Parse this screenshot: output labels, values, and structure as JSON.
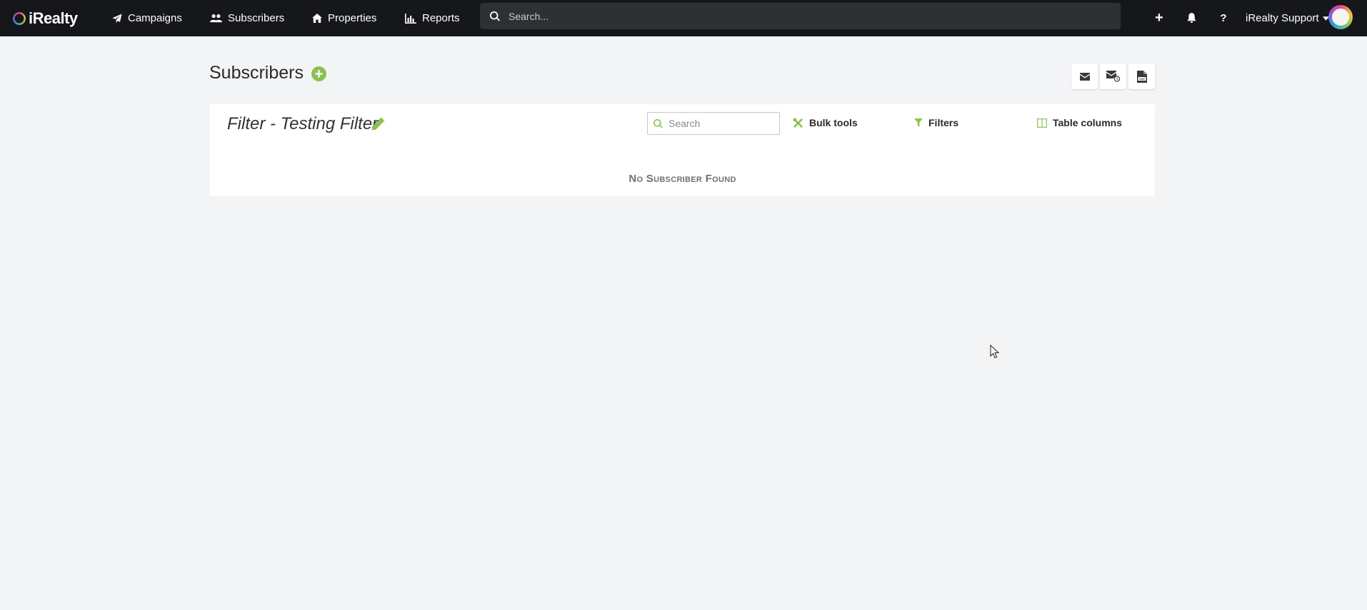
{
  "app": {
    "brand": "iRealty",
    "colors": {
      "nav_bg": "#15171a",
      "accent_green": "#8cc152",
      "page_bg": "#f3f4f6"
    }
  },
  "nav": {
    "items": [
      {
        "label": "Campaigns",
        "icon": "paper-plane-icon"
      },
      {
        "label": "Subscribers",
        "icon": "users-icon"
      },
      {
        "label": "Properties",
        "icon": "home-icon"
      },
      {
        "label": "Reports",
        "icon": "bar-chart-icon"
      }
    ],
    "search_placeholder": "Search...",
    "add_label": "+",
    "help_label": "?",
    "user_name": "iRealty Support"
  },
  "page": {
    "title": "Subscribers",
    "add_label": "+",
    "tools": [
      "envelope-icon",
      "scheduled-envelope-icon",
      "csv-file-icon"
    ]
  },
  "panel": {
    "filter_title": "Filter - Testing Filter",
    "search_placeholder": "Search",
    "bulk_tools_label": "Bulk tools",
    "filters_label": "Filters",
    "table_columns_label": "Table columns",
    "empty_message": "No Subscriber Found"
  }
}
